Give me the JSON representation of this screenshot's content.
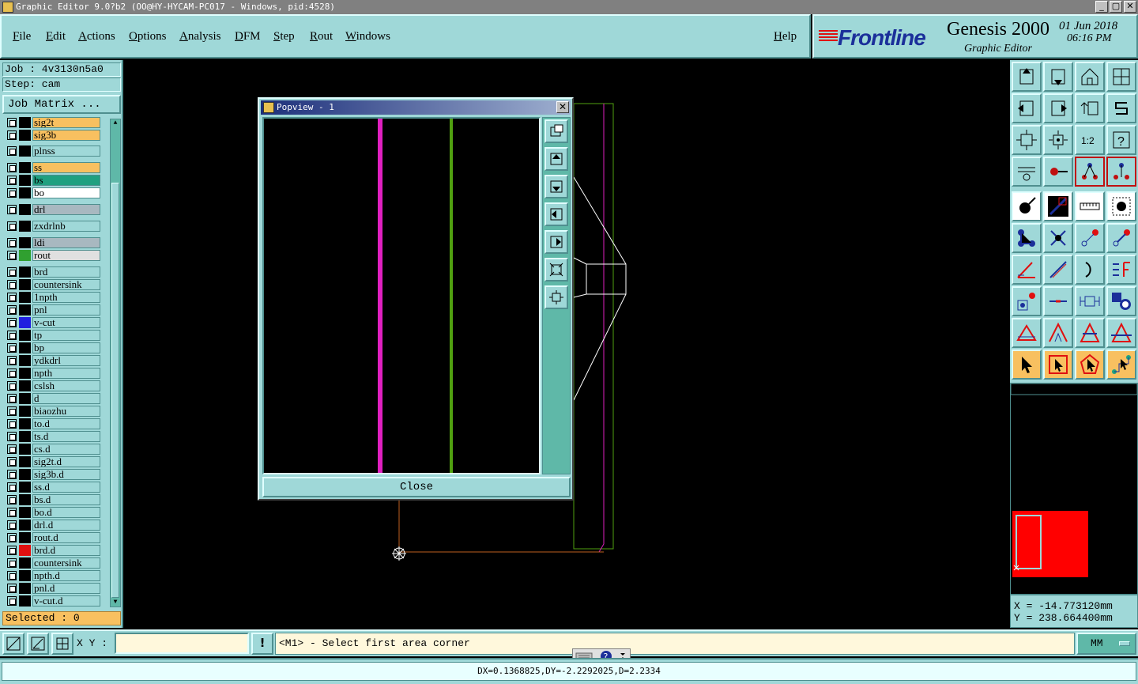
{
  "window": {
    "title": "Graphic Editor 9.0?b2 (OO@HY-HYCAM-PC017 - Windows, pid:4528)"
  },
  "menu": {
    "file": "File",
    "edit": "Edit",
    "actions": "Actions",
    "options": "Options",
    "analysis": "Analysis",
    "dfm": "DFM",
    "step": "Step",
    "rout": "Rout",
    "windows": "Windows",
    "help": "Help"
  },
  "brand": {
    "logo": "Frontline",
    "product": "Genesis 2000",
    "subtitle": "Graphic Editor",
    "date": "01 Jun 2018",
    "time": "06:16 PM"
  },
  "job": {
    "job_label": "Job : 4v3130n5a0",
    "step_label": "Step: cam",
    "matrix_button": "Job Matrix ...",
    "selected": "Selected : 0"
  },
  "layers": [
    {
      "name": "sig2t",
      "color": "#f8c060",
      "swatch": "#000000"
    },
    {
      "name": "sig3b",
      "color": "#f8c060",
      "swatch": "#000000"
    },
    {
      "name": "plnss",
      "color": "#9fd8d8",
      "swatch": "#000000"
    },
    {
      "name": "ss",
      "color": "#f8c060",
      "swatch": "#000000"
    },
    {
      "name": "bs",
      "color": "#20a080",
      "swatch": "#000000"
    },
    {
      "name": "bo",
      "color": "#ffffff",
      "swatch": "#000000"
    },
    {
      "name": "drl",
      "color": "#a8b8c0",
      "swatch": "#000000"
    },
    {
      "name": "zxdrlnb",
      "color": "#9fd8d8",
      "swatch": "#000000"
    },
    {
      "name": "ldi",
      "color": "#a8b8c0",
      "swatch": "#000000"
    },
    {
      "name": "rout",
      "color": "#e0e0e0",
      "swatch": "#30a030"
    },
    {
      "name": "brd",
      "color": "#9fd8d8",
      "swatch": "#000000"
    },
    {
      "name": "countersink",
      "color": "#9fd8d8",
      "swatch": "#000000"
    },
    {
      "name": "1npth",
      "color": "#9fd8d8",
      "swatch": "#000000"
    },
    {
      "name": "pnl",
      "color": "#9fd8d8",
      "swatch": "#000000"
    },
    {
      "name": "v-cut",
      "color": "#9fd8d8",
      "swatch": "#2020e0"
    },
    {
      "name": "tp",
      "color": "#9fd8d8",
      "swatch": "#000000"
    },
    {
      "name": "bp",
      "color": "#9fd8d8",
      "swatch": "#000000"
    },
    {
      "name": "ydkdrl",
      "color": "#9fd8d8",
      "swatch": "#000000"
    },
    {
      "name": "npth",
      "color": "#9fd8d8",
      "swatch": "#000000"
    },
    {
      "name": "cslsh",
      "color": "#9fd8d8",
      "swatch": "#000000"
    },
    {
      "name": "d",
      "color": "#9fd8d8",
      "swatch": "#000000"
    },
    {
      "name": "biaozhu",
      "color": "#9fd8d8",
      "swatch": "#000000"
    },
    {
      "name": "to.d",
      "color": "#9fd8d8",
      "swatch": "#000000"
    },
    {
      "name": "ts.d",
      "color": "#9fd8d8",
      "swatch": "#000000"
    },
    {
      "name": "cs.d",
      "color": "#9fd8d8",
      "swatch": "#000000"
    },
    {
      "name": "sig2t.d",
      "color": "#9fd8d8",
      "swatch": "#000000"
    },
    {
      "name": "sig3b.d",
      "color": "#9fd8d8",
      "swatch": "#000000"
    },
    {
      "name": "ss.d",
      "color": "#9fd8d8",
      "swatch": "#000000"
    },
    {
      "name": "bs.d",
      "color": "#9fd8d8",
      "swatch": "#000000"
    },
    {
      "name": "bo.d",
      "color": "#9fd8d8",
      "swatch": "#000000"
    },
    {
      "name": "drl.d",
      "color": "#9fd8d8",
      "swatch": "#000000"
    },
    {
      "name": "rout.d",
      "color": "#9fd8d8",
      "swatch": "#000000"
    },
    {
      "name": "brd.d",
      "color": "#9fd8d8",
      "swatch": "#e01010"
    },
    {
      "name": "countersink",
      "color": "#9fd8d8",
      "swatch": "#000000"
    },
    {
      "name": "npth.d",
      "color": "#9fd8d8",
      "swatch": "#000000"
    },
    {
      "name": "pnl.d",
      "color": "#9fd8d8",
      "swatch": "#000000"
    },
    {
      "name": "v-cut.d",
      "color": "#9fd8d8",
      "swatch": "#000000"
    }
  ],
  "popview": {
    "title": "Popview - 1",
    "close_button": "Close"
  },
  "coords": {
    "x": "X = -14.773120mm",
    "y": "Y = 238.664400mm"
  },
  "bottom": {
    "xy_label": "X Y :",
    "xy_value": "",
    "exclaim": "!",
    "prompt": "<M1> - Select first area corner",
    "units": "MM",
    "status": "DX=0.1368825,DY=-2.2292025,D=2.2334"
  },
  "colors": {
    "panel": "#9fd8d8",
    "accent_orange": "#f8c060",
    "magenta_line": "#e020c0",
    "green_line": "#50a010",
    "minimap_fill": "#ff0000"
  }
}
